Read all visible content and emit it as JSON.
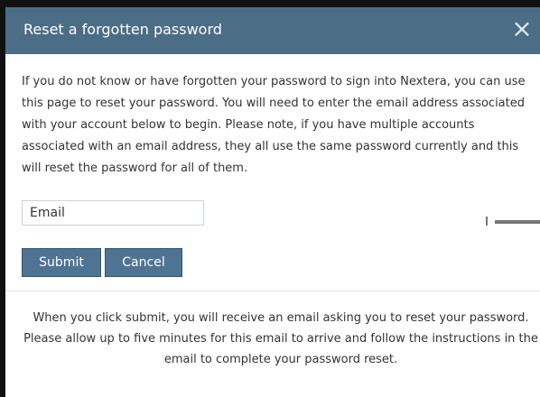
{
  "dialog": {
    "title": "Reset a forgotten password",
    "close_icon": "close-icon"
  },
  "instructions": {
    "text": "If you do not know or have forgotten your password to sign into Nextera, you can use this page to reset your password. You will need to enter the email address associated with your account below to begin. Please note, if you have multiple accounts associated with an email address, they all use the same password currently and this will reset the password for all of them."
  },
  "form": {
    "email_placeholder": "Email",
    "submit_label": "Submit",
    "cancel_label": "Cancel"
  },
  "message": {
    "text": "When you click submit, you will receive an email asking you to reset your password. Please allow up to five minutes for this email to arrive and follow the instructions in the email to complete your password reset."
  },
  "colors": {
    "header_bg": "#4c6d86",
    "button_bg": "#4f7393",
    "text": "#333333"
  }
}
